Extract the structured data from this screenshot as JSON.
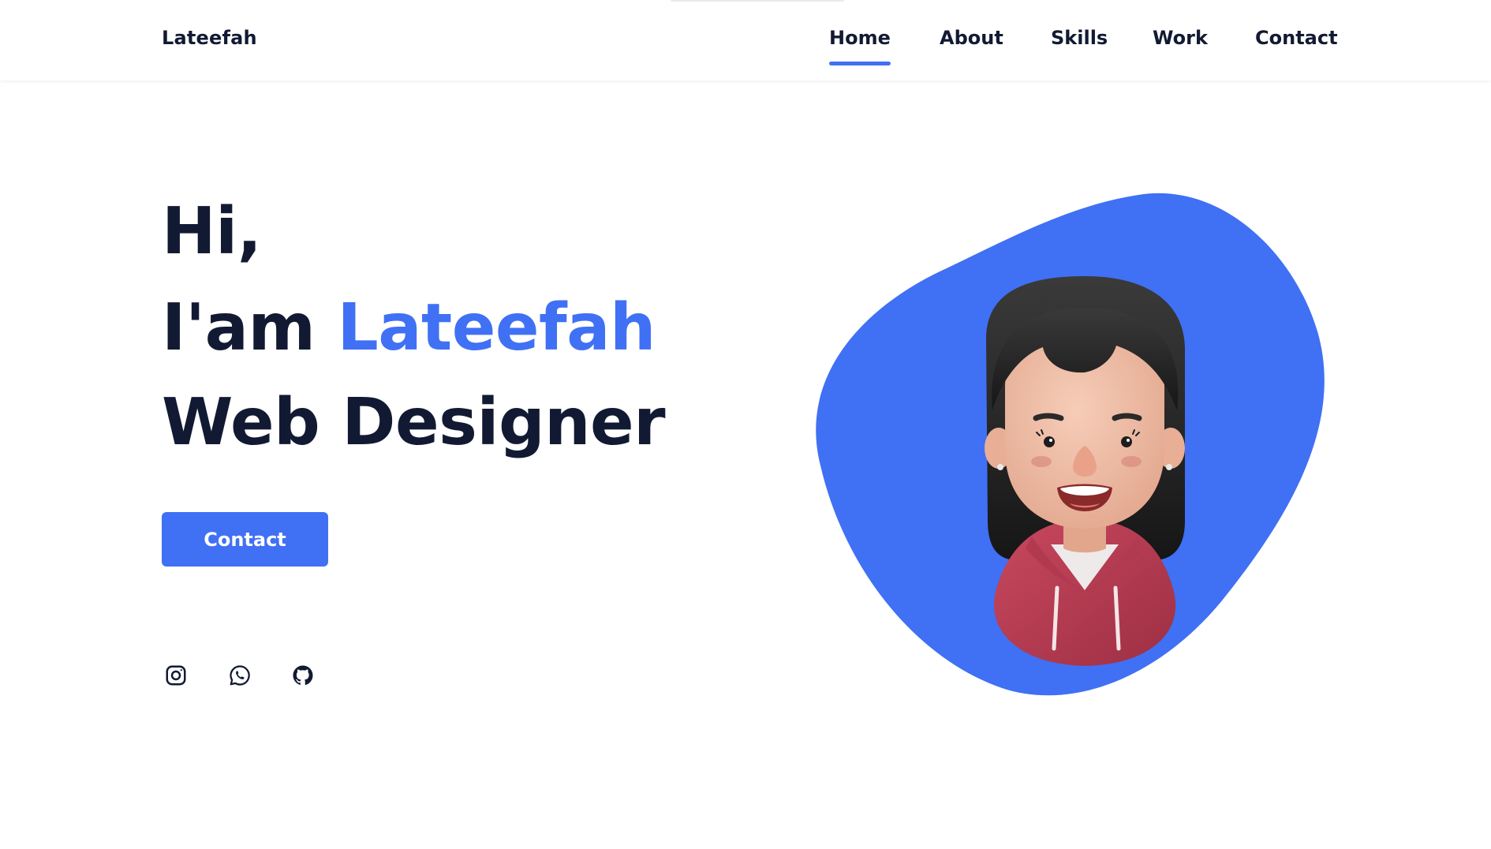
{
  "brand": {
    "name": "Lateefah"
  },
  "nav": {
    "items": [
      {
        "label": "Home",
        "active": true
      },
      {
        "label": "About",
        "active": false
      },
      {
        "label": "Skills",
        "active": false
      },
      {
        "label": "Work",
        "active": false
      },
      {
        "label": "Contact",
        "active": false
      }
    ]
  },
  "hero": {
    "greeting": "Hi,",
    "intro_prefix": "I'am",
    "name": "Lateefah",
    "role": "Web Designer",
    "contact_button": "Contact"
  },
  "social": [
    {
      "icon": "instagram-icon"
    },
    {
      "icon": "whatsapp-icon"
    },
    {
      "icon": "github-icon"
    }
  ],
  "colors": {
    "accent": "#4070f4",
    "text": "#121a33",
    "background": "#ffffff"
  }
}
